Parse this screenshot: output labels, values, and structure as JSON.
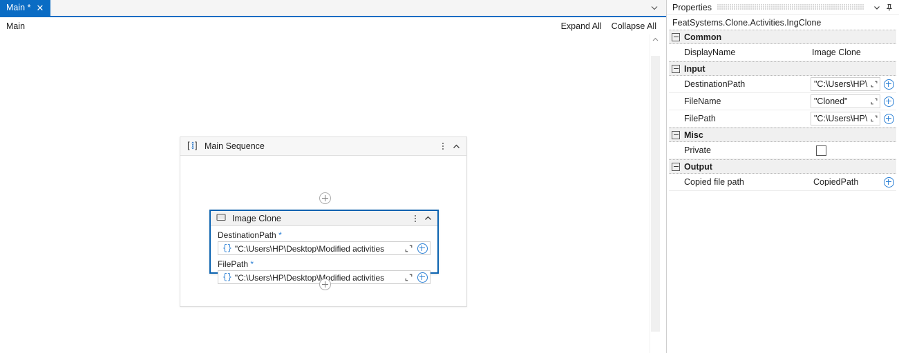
{
  "colors": {
    "accent": "#0a6cc4",
    "selection_border": "#0a62b0",
    "expression_blue": "#2a7fd4",
    "category_bg": "#f0f0f0"
  },
  "tabs": [
    {
      "label": "Main *",
      "close_icon": "close-icon",
      "active": true
    }
  ],
  "tabstrip": {
    "overflow_icon": "chevron-down-icon"
  },
  "breadcrumb": {
    "path": "Main",
    "expand_all": "Expand All",
    "collapse_all": "Collapse All"
  },
  "canvas": {
    "scrollbar": {
      "up_arrow_icon": "chevron-up-icon"
    },
    "sequence": {
      "icon": "sequence-icon",
      "title": "Main Sequence",
      "menu_icon": "kebab-menu-icon",
      "collapse_icon": "chevron-up-icon",
      "add_top_icon": "plus-circle-icon",
      "add_bottom_icon": "plus-circle-icon",
      "activity": {
        "icon": "image-icon",
        "title": "Image Clone",
        "menu_icon": "kebab-menu-icon",
        "collapse_icon": "chevron-up-icon",
        "fields": [
          {
            "label": "DestinationPath",
            "required_marker": "*",
            "expression_icon": "braces-icon",
            "value": "\"C:\\Users\\HP\\Desktop\\Modified activities",
            "open_editor_icon": "open-expression-editor-icon",
            "add_icon": "plus-circle-icon"
          },
          {
            "label": "FilePath",
            "required_marker": "*",
            "expression_icon": "braces-icon",
            "value": "\"C:\\Users\\HP\\Desktop\\Modified activities",
            "open_editor_icon": "open-expression-editor-icon",
            "add_icon": "plus-circle-icon"
          }
        ]
      }
    }
  },
  "properties": {
    "title": "Properties",
    "dropdown_icon": "chevron-down-icon",
    "pin_icon": "pin-icon",
    "class_name": "FeatSystems.Clone.Activities.IngClone",
    "categories": [
      {
        "name": "Common",
        "toggle_icon": "collapse-box-icon",
        "rows": [
          {
            "name": "DisplayName",
            "value": "Image Clone",
            "editor": "plain"
          }
        ]
      },
      {
        "name": "Input",
        "toggle_icon": "collapse-box-icon",
        "rows": [
          {
            "name": "DestinationPath",
            "value": "\"C:\\Users\\HP\\",
            "editor": "expression",
            "open_editor_icon": "open-expression-editor-icon",
            "add_icon": "plus-circle-icon"
          },
          {
            "name": "FileName",
            "value": "\"Cloned\"",
            "editor": "expression",
            "open_editor_icon": "open-expression-editor-icon",
            "add_icon": "plus-circle-icon"
          },
          {
            "name": "FilePath",
            "value": "\"C:\\Users\\HP\\",
            "editor": "expression",
            "open_editor_icon": "open-expression-editor-icon",
            "add_icon": "plus-circle-icon"
          }
        ]
      },
      {
        "name": "Misc",
        "toggle_icon": "collapse-box-icon",
        "rows": [
          {
            "name": "Private",
            "value": "",
            "editor": "checkbox",
            "checked": false
          }
        ]
      },
      {
        "name": "Output",
        "toggle_icon": "collapse-box-icon",
        "rows": [
          {
            "name": "Copied file path",
            "value": "CopiedPath",
            "editor": "expression-noborder",
            "add_icon": "plus-circle-icon"
          }
        ]
      }
    ]
  }
}
